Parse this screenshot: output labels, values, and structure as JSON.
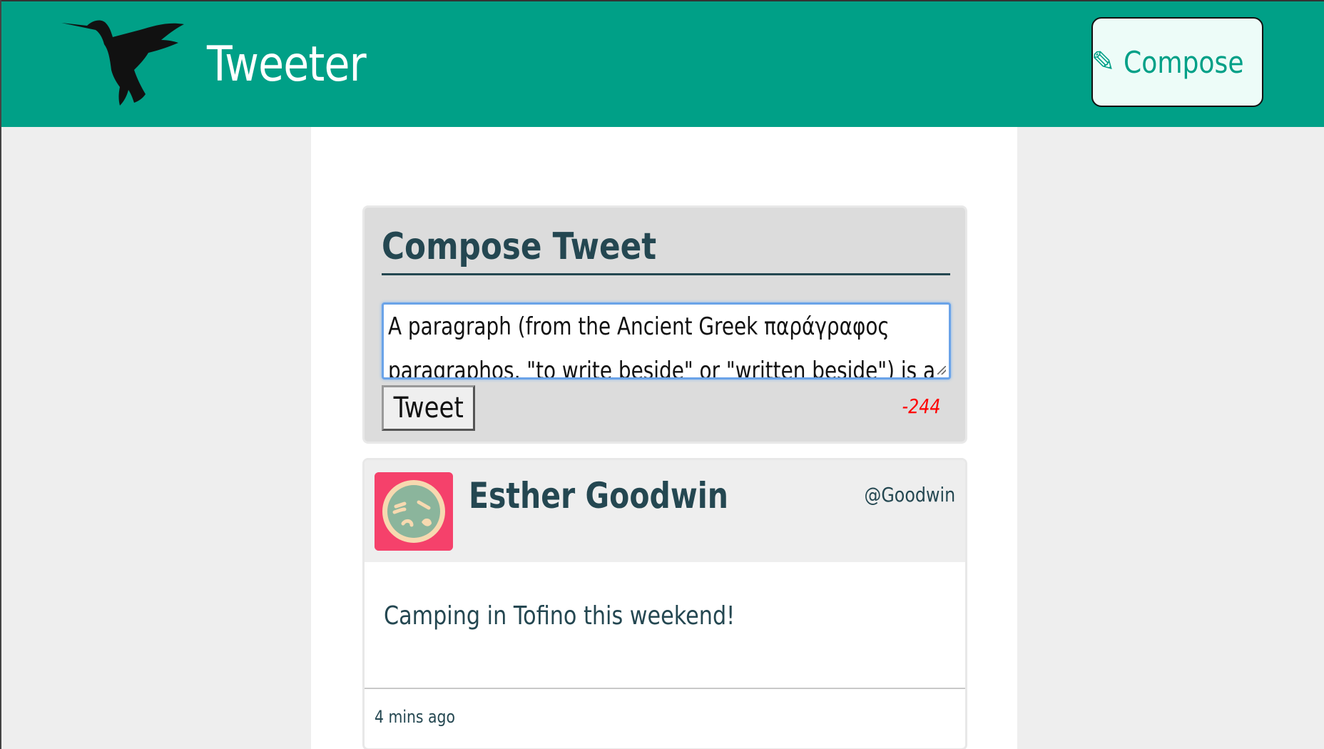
{
  "app": {
    "title": "Tweeter",
    "compose_label": "Compose",
    "compose_icon": "pencil-icon",
    "brand_color": "#00a087",
    "logo_icon": "hummingbird-icon"
  },
  "composer": {
    "heading": "Compose Tweet",
    "textarea_value": "A paragraph (from the Ancient Greek παράγραφος paragraphos, \"to write beside\" or \"written beside\") is a",
    "submit_label": "Tweet",
    "char_counter": "-244",
    "counter_color": "#ff0000"
  },
  "tweets": [
    {
      "name": "Esther Goodwin",
      "handle": "@Goodwin",
      "content": "Camping in Tofino this weekend!",
      "timestamp": "4 mins ago",
      "avatar_icon": "sleepy-face-avatar"
    }
  ]
}
